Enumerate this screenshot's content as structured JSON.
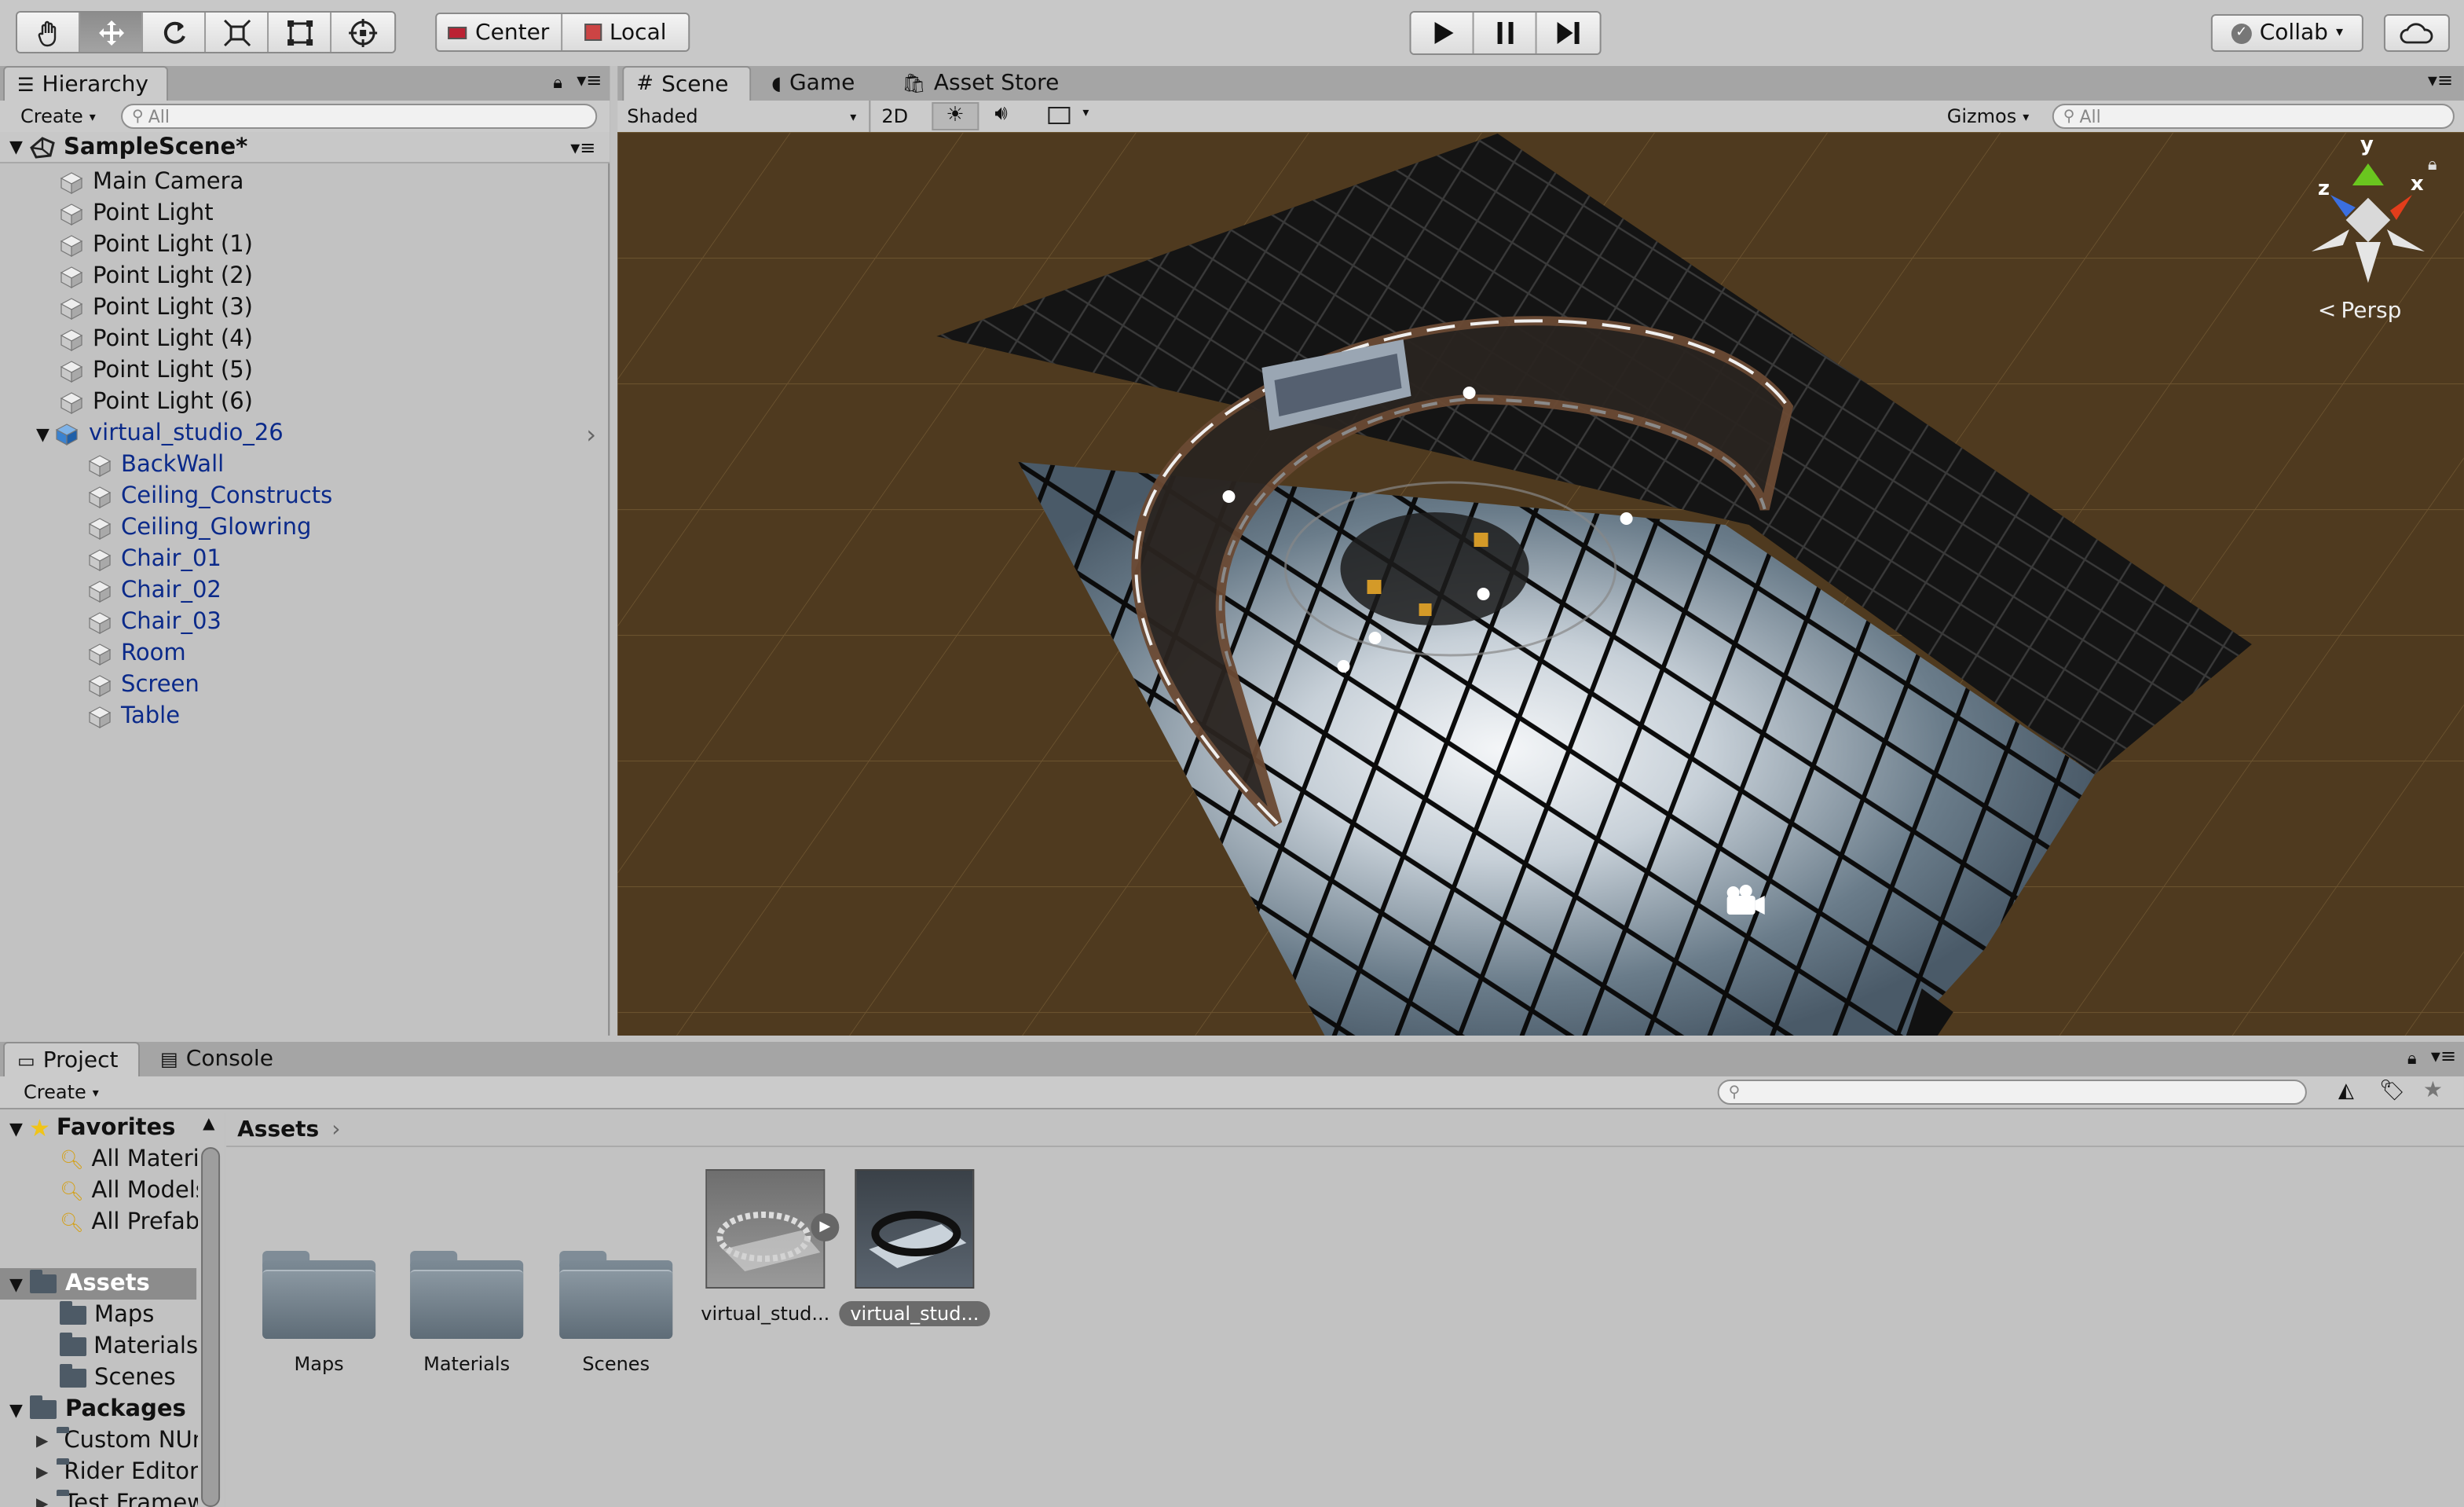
{
  "toolbar": {
    "tools": [
      "hand-tool",
      "move-tool",
      "rotate-tool",
      "scale-tool",
      "rect-tool",
      "transform-tool"
    ],
    "pivot_mode": "Center",
    "pivot_rotation": "Local",
    "collab_label": "Collab",
    "colors": {
      "active_tool": "#8c8c8c"
    }
  },
  "hierarchy": {
    "tab_label": "Hierarchy",
    "create_label": "Create",
    "search_placeholder": "All",
    "scene_name": "SampleScene*",
    "items": [
      {
        "label": "Main Camera"
      },
      {
        "label": "Point Light"
      },
      {
        "label": "Point Light (1)"
      },
      {
        "label": "Point Light (2)"
      },
      {
        "label": "Point Light (3)"
      },
      {
        "label": "Point Light (4)"
      },
      {
        "label": "Point Light (5)"
      },
      {
        "label": "Point Light (6)"
      },
      {
        "label": "virtual_studio_26"
      }
    ],
    "children": [
      {
        "label": "BackWall"
      },
      {
        "label": "Ceiling_Constructs"
      },
      {
        "label": "Ceiling_Glowring"
      },
      {
        "label": "Chair_01"
      },
      {
        "label": "Chair_02"
      },
      {
        "label": "Chair_03"
      },
      {
        "label": "Room"
      },
      {
        "label": "Screen"
      },
      {
        "label": "Table"
      }
    ]
  },
  "scene_view": {
    "tabs": [
      {
        "label": "Scene"
      },
      {
        "label": "Game"
      },
      {
        "label": "Asset Store"
      }
    ],
    "shading_mode": "Shaded",
    "mode_2d": "2D",
    "gizmos_label": "Gizmos",
    "search_placeholder": "All",
    "projection_label": "Persp",
    "axes": {
      "y": "y",
      "x": "x",
      "z": "z"
    }
  },
  "project": {
    "tabs": [
      {
        "label": "Project"
      },
      {
        "label": "Console"
      }
    ],
    "create_label": "Create",
    "breadcrumb": "Assets",
    "favorites_label": "Favorites",
    "favorites": [
      {
        "label": "All Materials"
      },
      {
        "label": "All Models"
      },
      {
        "label": "All Prefabs"
      }
    ],
    "assets_label": "Assets",
    "asset_folders": [
      {
        "label": "Maps"
      },
      {
        "label": "Materials"
      },
      {
        "label": "Scenes"
      }
    ],
    "packages_label": "Packages",
    "packages": [
      {
        "label": "Custom NUnit"
      },
      {
        "label": "Rider Editor"
      },
      {
        "label": "Test Framework"
      }
    ],
    "grid_items": [
      {
        "label": "Maps"
      },
      {
        "label": "Materials"
      },
      {
        "label": "Scenes"
      },
      {
        "label": "virtual_stud..."
      },
      {
        "label": "virtual_stud..."
      }
    ]
  }
}
